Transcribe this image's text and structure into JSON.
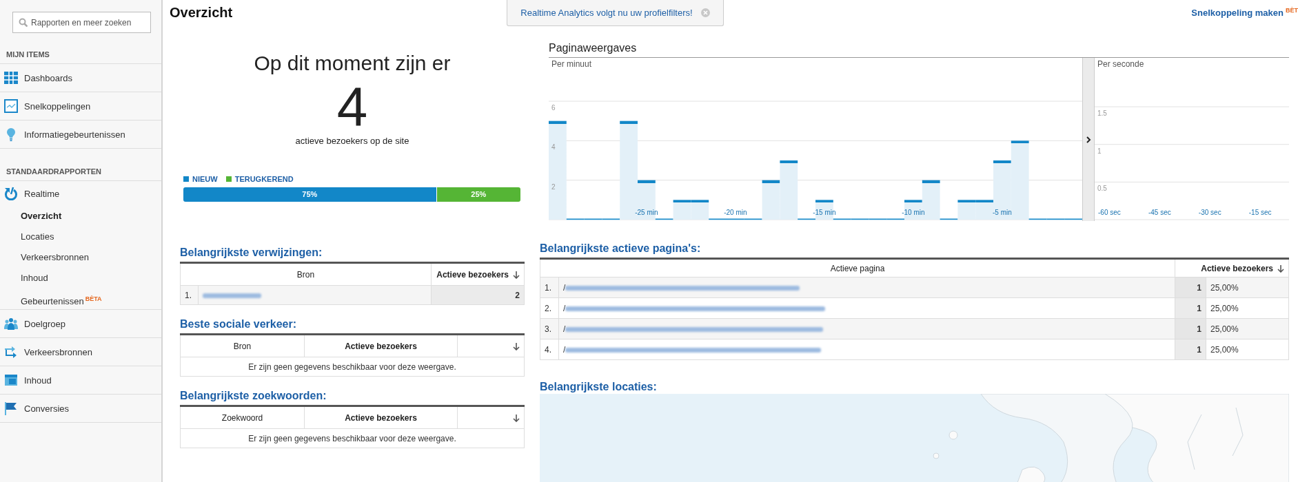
{
  "sidebar": {
    "search": {
      "placeholder": "Rapporten en meer zoeken"
    },
    "sections": [
      {
        "title": "MIJN ITEMS",
        "items": [
          {
            "label": "Dashboards"
          },
          {
            "label": "Snelkoppelingen"
          },
          {
            "label": "Informatiegebeurtenissen"
          }
        ]
      },
      {
        "title": "STANDAARDRAPPORTEN",
        "items": [
          {
            "label": "Realtime",
            "expanded": true,
            "children": [
              {
                "label": "Overzicht",
                "selected": true
              },
              {
                "label": "Locaties",
                "selected": false
              },
              {
                "label": "Verkeersbronnen",
                "selected": false
              },
              {
                "label": "Inhoud",
                "selected": false
              },
              {
                "label": "Gebeurtenissen",
                "selected": false,
                "badge": "BÈTA"
              }
            ]
          },
          {
            "label": "Doelgroep",
            "expanded": false
          },
          {
            "label": "Verkeersbronnen",
            "expanded": false
          },
          {
            "label": "Inhoud",
            "expanded": false
          },
          {
            "label": "Conversies",
            "expanded": false
          }
        ]
      }
    ]
  },
  "header": {
    "title": "Overzicht",
    "notice": "Realtime Analytics volgt nu uw profielfilters!",
    "shortcut": {
      "label": "Snelkoppeling maken",
      "badge": "BÈT"
    }
  },
  "visitors": {
    "heading": "Op dit moment zijn er",
    "count": "4",
    "caption": "actieve bezoekers op de site",
    "segments": [
      {
        "label": "NIEUW",
        "color": "#1287c8",
        "level": 0.75,
        "reading": "75%"
      },
      {
        "label": "TERUGKEREND",
        "color": "#55b535",
        "level": 0.25,
        "reading": "25%"
      }
    ]
  },
  "pageviews": {
    "title": "Paginaweergaves",
    "panels": [
      {
        "label": "Per minuut",
        "chart_data": {
          "type": "bar",
          "xlim": [
            -30.5,
            -0.5
          ],
          "x": [
            -30,
            -29,
            -28,
            -27,
            -26,
            -25,
            -24,
            -23,
            -22,
            -21,
            -20,
            -19,
            -18,
            -17,
            -16,
            -15,
            -14,
            -13,
            -12,
            -11,
            -10,
            -9,
            -8,
            -7,
            -6,
            -5,
            -4,
            -3,
            -2,
            -1
          ],
          "values": [
            5,
            0,
            0,
            0,
            5,
            2,
            0,
            1,
            1,
            0,
            0,
            0,
            2,
            3,
            0,
            1,
            0,
            0,
            0,
            0,
            1,
            2,
            0,
            1,
            1,
            3,
            4,
            0,
            0,
            0
          ],
          "ylim": [
            0,
            6
          ],
          "yticks": [
            2,
            4,
            6
          ],
          "grid": true,
          "xticks": [
            {
              "value": -25,
              "label": "-25 min"
            },
            {
              "value": -20,
              "label": "-20 min"
            },
            {
              "value": -15,
              "label": "-15 min"
            },
            {
              "value": -10,
              "label": "-10 min"
            },
            {
              "value": -5,
              "label": "-5 min"
            }
          ]
        }
      },
      {
        "label": "Per seconde",
        "chart_data": {
          "type": "bar",
          "xlim": [
            -64.4,
            -6.4
          ],
          "ylim": [
            0,
            2.15
          ],
          "yticks": [
            0.5,
            1,
            1.5
          ],
          "grid": true,
          "xticks": [
            {
              "value": -60,
              "label": "-60 sec"
            },
            {
              "value": -45,
              "label": "-45 sec"
            },
            {
              "value": -30,
              "label": "-30 sec"
            },
            {
              "value": -15,
              "label": "-15 sec"
            }
          ]
        }
      }
    ]
  },
  "referrals": {
    "title": "Belangrijkste verwijzingen:",
    "columns": [
      {
        "label": "Bron",
        "sorted": false
      },
      {
        "label": "Actieve bezoekers",
        "sorted": true
      }
    ],
    "rows": [
      {
        "index": "1.",
        "count": "2"
      }
    ]
  },
  "social": {
    "title": "Beste sociale verkeer:",
    "columns": [
      {
        "label": "Bron",
        "sorted": false
      },
      {
        "label": "Actieve bezoekers",
        "sorted": true
      }
    ],
    "empty": "Er zijn geen gegevens beschikbaar voor deze weergave."
  },
  "keywords": {
    "title": "Belangrijkste zoekwoorden:",
    "columns": [
      {
        "label": "Zoekwoord",
        "sorted": false
      },
      {
        "label": "Actieve bezoekers",
        "sorted": true
      }
    ],
    "empty": "Er zijn geen gegevens beschikbaar voor deze weergave."
  },
  "pages": {
    "title": "Belangrijkste actieve pagina's:",
    "columns": [
      {
        "label": "Actieve pagina",
        "sorted": false
      },
      {
        "label": "Actieve bezoekers",
        "sorted": true
      }
    ],
    "rows": [
      {
        "index": "1.",
        "path": "/",
        "count": "1",
        "share": "25,00%"
      },
      {
        "index": "2.",
        "path": "/",
        "count": "1",
        "share": "25,00%"
      },
      {
        "index": "3.",
        "path": "/",
        "count": "1",
        "share": "25,00%"
      },
      {
        "index": "4.",
        "path": "/",
        "count": "1",
        "share": "25,00%"
      }
    ]
  },
  "locations": {
    "title": "Belangrijkste locaties:"
  }
}
